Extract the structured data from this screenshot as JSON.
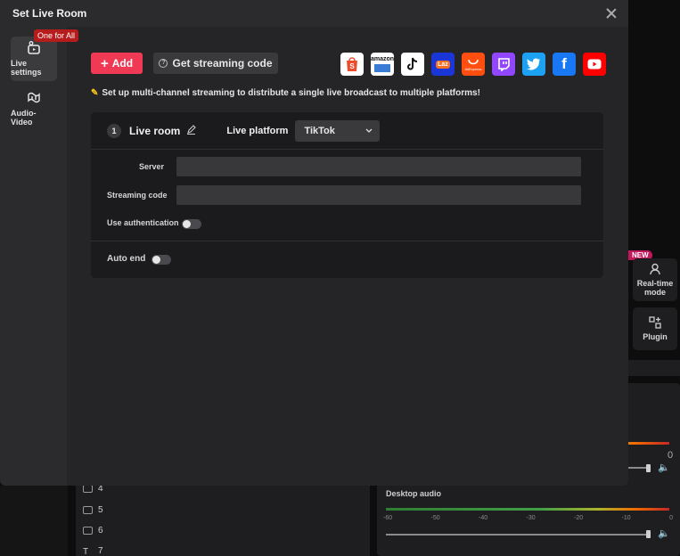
{
  "modal": {
    "title": "Set Live Room"
  },
  "side_nav": {
    "promo_badge": "One for All",
    "items": [
      {
        "label": "Live settings"
      },
      {
        "label": "Audio-Video"
      }
    ]
  },
  "toolbar": {
    "add_label": "Add",
    "streaming_code_label": "Get streaming code"
  },
  "platforms": [
    {
      "name": "Shopee",
      "icon": "shopee-icon",
      "color": "#ffffff",
      "text": "Shopee"
    },
    {
      "name": "Amazon",
      "icon": "amazon-icon",
      "color": "#ffffff",
      "text": "amazon"
    },
    {
      "name": "TikTok",
      "icon": "tiktok-icon",
      "color": "#ffffff",
      "text": "♪"
    },
    {
      "name": "Lazada",
      "icon": "lazada-icon",
      "color": "#1a36d6",
      "text": "Laz"
    },
    {
      "name": "AliExpress",
      "icon": "aliexpress-icon",
      "color": "#ff4e0f",
      "text": "AliExpress"
    },
    {
      "name": "Twitch",
      "icon": "twitch-icon",
      "color": "#9146ff",
      "text": ""
    },
    {
      "name": "Twitter",
      "icon": "twitter-icon",
      "color": "#1da1f2",
      "text": ""
    },
    {
      "name": "Facebook",
      "icon": "facebook-icon",
      "color": "#1877f2",
      "text": "f"
    },
    {
      "name": "YouTube",
      "icon": "youtube-icon",
      "color": "#ff0000",
      "text": ""
    }
  ],
  "tip": "Set up multi-channel streaming to distribute a single live broadcast to multiple platforms!",
  "room": {
    "number": "1",
    "name": "Live room",
    "platform_label": "Live platform",
    "platform_value": "TikTok",
    "server_label": "Server",
    "server_value": "",
    "code_label": "Streaming code",
    "code_value": "",
    "auth_label": "Use authentication",
    "auth_enabled": false,
    "auto_end_label": "Auto end",
    "auto_end_enabled": false
  },
  "background": {
    "new_badge": "NEW",
    "realtime_label": "Real-time mode",
    "plugin_label": "Plugin",
    "scenes": [
      "4",
      "5",
      "6",
      "7"
    ],
    "desktop_audio_label": "Desktop audio",
    "meter_ticks": [
      "-60",
      "-50",
      "-40",
      "-30",
      "-20",
      "-10",
      "0"
    ],
    "meter_end_label": "0"
  },
  "colors": {
    "accent": "#f03a55",
    "modal_bg": "#252527",
    "card_bg": "#1b1b1d"
  }
}
